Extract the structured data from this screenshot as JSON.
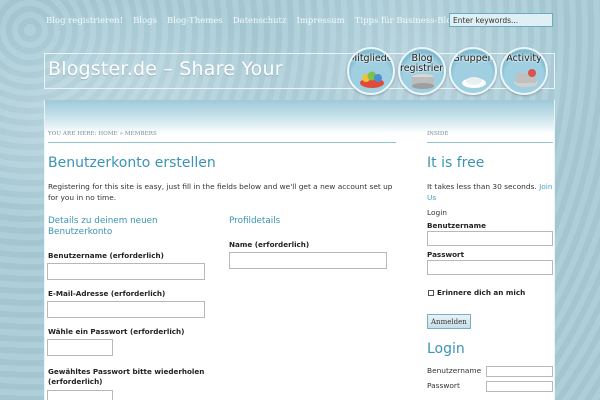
{
  "topnav": {
    "items": [
      "Blog registrieren!",
      "Blogs",
      "Blog-Themes",
      "Datenschutz",
      "Impressum",
      "Tipps für Business-Blog"
    ],
    "search_placeholder": "Enter keywords..."
  },
  "header": {
    "title": "Blogster.de – Share Your",
    "bubbles": [
      "Mitglieder",
      "Blog\nregistriere",
      "Gruppen",
      "Activity"
    ]
  },
  "breadcrumb": "YOU ARE HERE: HOME » MEMBERS",
  "main": {
    "title": "Benutzerkonto erstellen",
    "intro": "Registering for this site is easy, just fill in the fields below and we'll get a new account set up for you in no time.",
    "account_heading": "Details zu deinem neuen Benutzerkonto",
    "username_label": "Benutzername (erforderlich)",
    "email_label": "E-Mail-Adresse (erforderlich)",
    "password_label": "Wähle ein Passwort (erforderlich)",
    "password_repeat_label": "Gewähltes Passwort bitte wiederholen (erforderlich)",
    "profile_heading": "Profildetails",
    "name_label": "Name (erforderlich)"
  },
  "sidebar": {
    "heading": "INSIDE",
    "title": "It is free",
    "text": "It takes less than 30 seconds.",
    "join_link": "Join Us",
    "login_small": "Login",
    "username_label": "Benutzername",
    "password_label": "Passwort",
    "remember_label": "Erinnere dich an mich",
    "login_button": "Anmelden",
    "login_title": "Login",
    "username_label2": "Benutzername",
    "password_label2": "Passwort"
  },
  "colors": {
    "accent": "#3a94b3",
    "background": "#a9ccd8"
  }
}
